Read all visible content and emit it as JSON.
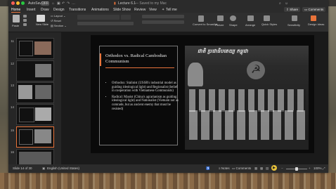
{
  "window": {
    "autosave_label": "AutoSave",
    "autosave_state": "OFF",
    "doc_title": "Lecture 6.1",
    "saved_status": "— Saved to my Mac"
  },
  "tabs": [
    "Home",
    "Insert",
    "Draw",
    "Design",
    "Transitions",
    "Animations",
    "Slide Show",
    "Review",
    "View",
    "Tell me"
  ],
  "active_tab": "Home",
  "ribbon_actions": {
    "share": "Share",
    "comments": "Comments"
  },
  "ribbon": {
    "paste": "Paste",
    "new_slide": "New Slide",
    "layout": "Layout",
    "reset": "Reset",
    "section": "Section",
    "convert_smartart": "Convert to SmartArt",
    "picture": "Picture",
    "shape": "Shape",
    "arrange": "Arrange",
    "quick_styles": "Quick Styles",
    "sensitivity": "Sensitivity",
    "design_ideas": "Design Ideas"
  },
  "thumbnails": [
    "11",
    "12",
    "13",
    "14",
    "15",
    "16"
  ],
  "selected_thumbnail": "14",
  "slide": {
    "title": "Orthodox vs. Radical Cambodian Communism",
    "bullets": [
      "Orthodox: Stalinist (USSR's industrial model as guiding ideological light) and Regionalist (belief in cooperation with Vietnamese Communists)",
      "Radical: Maoist (China's agrarianism as guiding ideological light) and Nationalist (Vietnam not as comrade, but as ancient enemy that must be resisted)"
    ],
    "photo_banner": "ជាតិ ប្រជាធិបតេយ្យ កម្ពុជា"
  },
  "status": {
    "slide_indicator": "Slide 14 of 30",
    "language": "English (United States)",
    "notes": "Notes",
    "comments": "Comments",
    "zoom": "100%"
  },
  "colors": {
    "accent": "#e8733a",
    "window_bg": "#1e1e1e",
    "slide_bg": "#0a0a0a"
  }
}
